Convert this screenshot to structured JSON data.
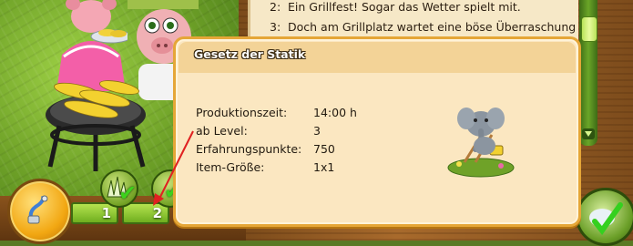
{
  "quest_log": {
    "lines": [
      {
        "num": "2:",
        "text": "Ein Grillfest! Sogar das Wetter spielt mit."
      },
      {
        "num": "3:",
        "text": "Doch am Grillplatz wartet eine böse Überraschung"
      }
    ]
  },
  "tooltip": {
    "title": "Gesetz der Statik",
    "stats": [
      {
        "label": "Produktionszeit:",
        "value": "14:00 h"
      },
      {
        "label": "ab Level:",
        "value": "3"
      },
      {
        "label": "Erfahrungspunkte:",
        "value": "750"
      },
      {
        "label": "Item-Größe:",
        "value": "1x1"
      }
    ],
    "item_icon": "elephant-statue-icon"
  },
  "hud": {
    "slots": [
      {
        "number": "1",
        "icon": "grass-checkmark-icon"
      },
      {
        "number": "2",
        "icon": "checkmark-icon"
      }
    ],
    "tool_icon": "water-hose-icon"
  },
  "colors": {
    "tooltip_bg": "#fbe7c1",
    "tooltip_border": "#e5a637",
    "annotation_arrow": "#e02020"
  }
}
